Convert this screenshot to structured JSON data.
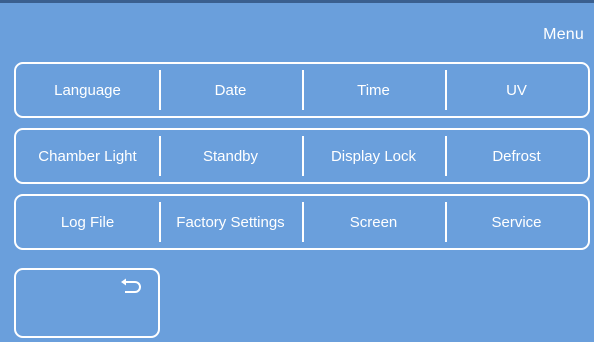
{
  "header": {
    "title": "Menu"
  },
  "menu": {
    "row1": [
      "Language",
      "Date",
      "Time",
      "UV"
    ],
    "row2": [
      "Chamber Light",
      "Standby",
      "Display Lock",
      "Defrost"
    ],
    "row3": [
      "Log File",
      "Factory Settings",
      "Screen",
      "Service"
    ]
  },
  "back_button": {
    "icon": "return-arrow-icon"
  },
  "colors": {
    "background": "#6a9fdc",
    "border": "#ffffff",
    "text": "#ffffff"
  }
}
